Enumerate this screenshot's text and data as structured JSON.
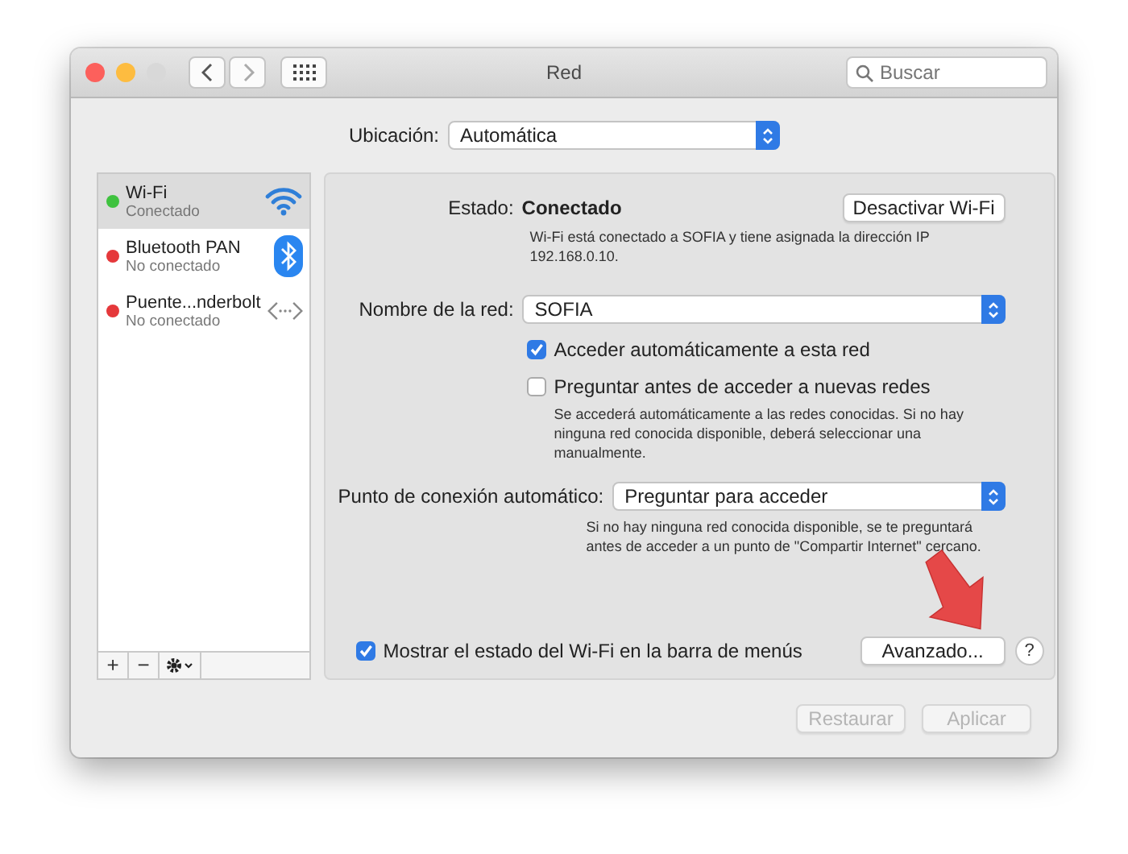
{
  "window": {
    "title": "Red",
    "search": {
      "placeholder": "Buscar"
    }
  },
  "location": {
    "label": "Ubicación:",
    "value": "Automática"
  },
  "services": [
    {
      "name": "Wi-Fi",
      "status": "Conectado",
      "color": "#3fc23f",
      "kind": "wifi",
      "selected": true
    },
    {
      "name": "Bluetooth PAN",
      "status": "No conectado",
      "color": "#e5383b",
      "kind": "bluetooth",
      "selected": false
    },
    {
      "name": "Puente...nderbolt",
      "status": "No conectado",
      "color": "#e5383b",
      "kind": "bridge",
      "selected": false
    }
  ],
  "sidebar_tools": [
    "+",
    "−"
  ],
  "detail": {
    "status_label": "Estado:",
    "status_value": "Conectado",
    "toggle_button": "Desactivar Wi-Fi",
    "status_note": "Wi-Fi está conectado a SOFIA y tiene asignada la dirección IP 192.168.0.10.",
    "network_label": "Nombre de la red:",
    "network_value": "SOFIA",
    "options": [
      {
        "label": "Acceder automáticamente a esta red",
        "checked": true
      },
      {
        "label": "Preguntar antes de acceder a nuevas redes",
        "checked": false,
        "note": "Se accederá automáticamente a las redes conocidas. Si no hay ninguna red conocida disponible, deberá seleccionar una manualmente."
      }
    ],
    "hotspot_label": "Punto de conexión automático:",
    "hotspot_value": "Preguntar para acceder",
    "hotspot_note": "Si no hay ninguna red conocida disponible, se te preguntará antes de acceder a un punto de \"Compartir Internet\" cercano.",
    "menu_bar_option": {
      "label": "Mostrar el estado del Wi-Fi en la barra de menús",
      "checked": true
    },
    "advanced_button": "Avanzado...",
    "help_button": "?"
  },
  "footer_buttons": [
    {
      "label": "Restaurar",
      "disabled": true
    },
    {
      "label": "Aplicar",
      "disabled": true
    }
  ]
}
